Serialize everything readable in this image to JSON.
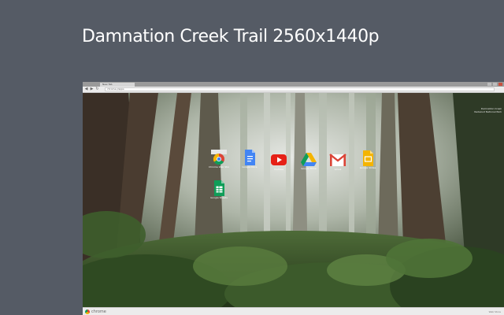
{
  "headline": "Damnation Creek Trail 2560x1440p",
  "browser": {
    "tab_label": "New Tab",
    "back_glyph": "◀",
    "forward_glyph": "▶",
    "reload_glyph": "↻",
    "url": "chrome://apps",
    "window_controls": [
      "minimize",
      "maximize",
      "close"
    ]
  },
  "corner_info": {
    "line1": "Damnation Creek",
    "line2": "Redwood National Park"
  },
  "apps": [
    {
      "name": "Chrome Web Store",
      "icon": "chrome-icon"
    },
    {
      "name": "Google Docs",
      "icon": "docs-icon"
    },
    {
      "name": "YouTube",
      "icon": "youtube-icon"
    },
    {
      "name": "Google Drive",
      "icon": "drive-icon"
    },
    {
      "name": "Gmail",
      "icon": "gmail-icon"
    },
    {
      "name": "Google Slides",
      "icon": "slides-icon"
    },
    {
      "name": "Google Sheets",
      "icon": "sheets-icon"
    }
  ],
  "taskbar": {
    "label": "chrome",
    "right_text": "Web Store"
  },
  "colors": {
    "page_background": "#555b65",
    "headline": "#ffffff",
    "chrome_red": "#db4437",
    "chrome_yellow": "#f4b400",
    "chrome_green": "#0f9d58",
    "docs_blue": "#4285f4",
    "youtube_red": "#e62117",
    "slides_yellow": "#f4b400",
    "sheets_green": "#0f9d58"
  }
}
